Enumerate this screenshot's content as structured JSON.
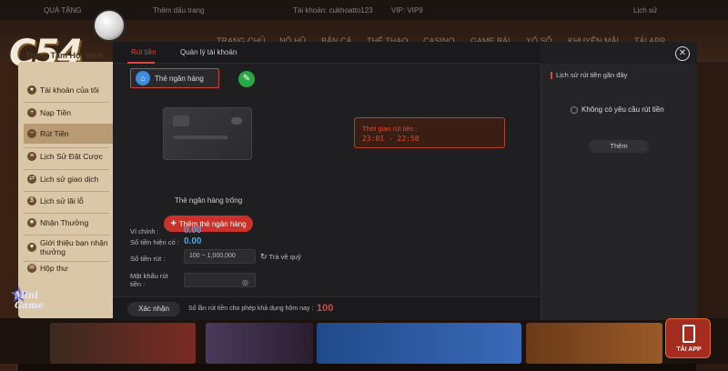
{
  "topbar": {
    "gift": "QUÀ TẶNG",
    "deposit": "Thêm dấu trang",
    "account": "Tài khoản: cukhoatto123",
    "vip": "VIP: VIP9",
    "points": "Lịch sử"
  },
  "nav": [
    "TRANG CHỦ",
    "NỔ HŨ",
    "BẮN CÁ",
    "THỂ THAO",
    "CASINO",
    "GAME BÀI",
    "XỔ SỐ",
    "KHUYẾN MÃI",
    "TẢI APP"
  ],
  "logo": {
    "text": "C54"
  },
  "sidebar": {
    "header": "Trung Tâm Hội Viên",
    "items": [
      {
        "label": "Tài khoản của tôi",
        "icon": "user-icon"
      },
      {
        "label": "Nạp Tiền",
        "icon": "deposit-icon"
      },
      {
        "label": "Rút Tiền",
        "icon": "withdraw-icon"
      },
      {
        "label": "Lịch Sử Đặt Cược",
        "icon": "bet-history-icon"
      },
      {
        "label": "Lịch sử giao dịch",
        "icon": "transaction-icon"
      },
      {
        "label": "Lịch sử lãi lỗ",
        "icon": "profit-icon"
      },
      {
        "label": "Nhận Thưởng",
        "icon": "reward-icon"
      },
      {
        "label": "Giới thiệu bạn nhận thưởng",
        "icon": "referral-icon"
      },
      {
        "label": "Hộp thư",
        "icon": "mail-icon"
      }
    ]
  },
  "modal": {
    "tabs": [
      "Rút tiền",
      "Quản lý tài khoản"
    ],
    "bank_tab": "Thẻ ngân hàng",
    "card_empty": "Thẻ ngân hàng trống",
    "add_bank": "Thêm thẻ ngân hàng",
    "time_title": "Thời gian rút tiền :",
    "time_value": "23:01  -  22:58",
    "wallet_label": "Ví chính :",
    "wallet_value": "0.00",
    "available_label": "Số tiền hiện có :",
    "available_value": "0.00",
    "amount_label": "Số tiền rút :",
    "amount_placeholder": "100 ~ 1,000,000",
    "refund": "Trả về quỹ",
    "password_label": "Mật khẩu rút tiền :",
    "confirm": "Xác nhận",
    "limit_text": "Số lần rút tiền cho phép khả dụng hôm nay :",
    "limit_value": "100",
    "history_title": "Lịch sử rút tiền gần đây",
    "no_request": "Không có yêu cầu rút tiền",
    "more": "Thêm"
  },
  "mini_logo": "Mini Game",
  "tai_app": "TẢI APP",
  "colors": {
    "accent": "#e0443a",
    "sidebar": "#d9c7a8",
    "modal_bg": "#1f1f21",
    "amount": "#49a6e8"
  }
}
